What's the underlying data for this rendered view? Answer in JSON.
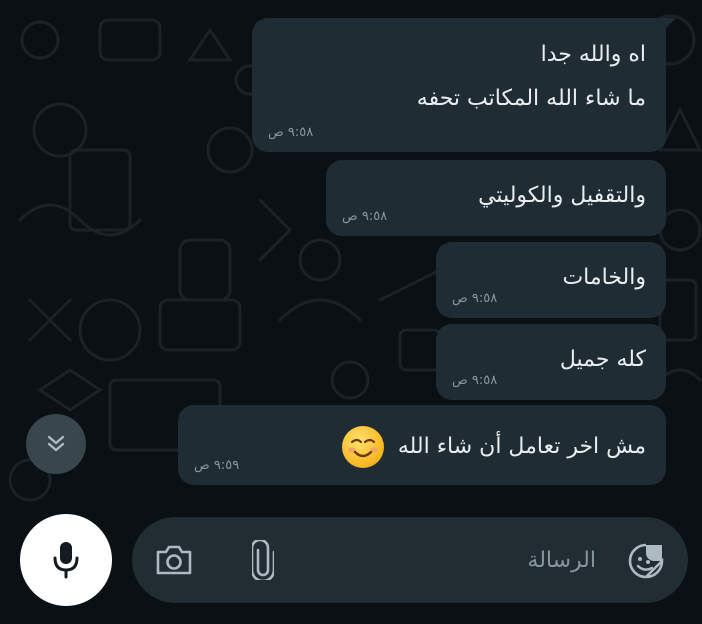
{
  "messages": [
    {
      "lines": [
        "اه والله جدا",
        "ما شاء الله المكاتب تحفه"
      ],
      "time": "٩:٥٨ ص"
    },
    {
      "lines": [
        "والتقفيل والكوليتي"
      ],
      "time": "٩:٥٨ ص"
    },
    {
      "lines": [
        "والخامات"
      ],
      "time": "٩:٥٨ ص"
    },
    {
      "lines": [
        "كله جميل"
      ],
      "time": "٩:٥٨ ص"
    },
    {
      "lines": [
        "مش اخر تعامل أن شاء الله"
      ],
      "time": "٩:٥٩ ص",
      "emoji": "smiling-face-icon"
    }
  ],
  "composer": {
    "placeholder": "الرسالة"
  },
  "icons": {
    "scroll": "double-chevron-down-icon",
    "mic": "microphone-icon",
    "camera": "camera-icon",
    "attach": "paperclip-icon",
    "sticker": "sticker-icon"
  },
  "colors": {
    "background": "#0b1014",
    "bubble": "#202c33",
    "text": "#e9edef",
    "time": "#8696a0",
    "composer": "#222c33"
  }
}
